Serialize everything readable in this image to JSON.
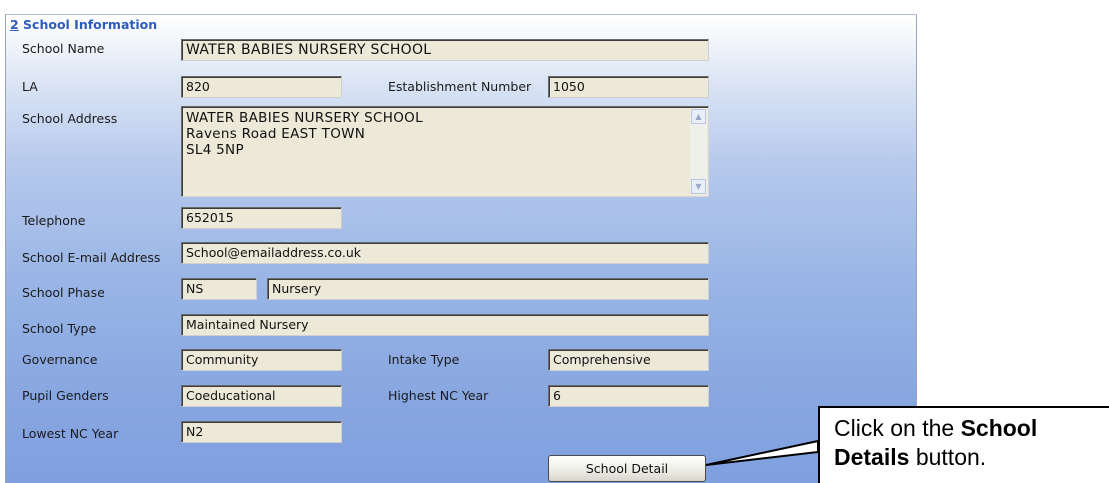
{
  "section": {
    "number": "2",
    "title": " School Information"
  },
  "labels": {
    "school_name": "School Name",
    "la": "LA",
    "establishment_number": "Establishment Number",
    "school_address": "School Address",
    "telephone": "Telephone",
    "email": "School E-mail Address",
    "phase": "School Phase",
    "type": "School Type",
    "governance": "Governance",
    "intake_type": "Intake Type",
    "pupil_genders": "Pupil Genders",
    "highest_nc_year": "Highest NC Year",
    "lowest_nc_year": "Lowest NC Year"
  },
  "values": {
    "school_name": "WATER BABIES NURSERY SCHOOL",
    "la": "820",
    "establishment_number": "1050",
    "address_lines": [
      "WATER BABIES NURSERY SCHOOL",
      "Ravens Road  EAST TOWN",
      "SL4 5NP"
    ],
    "telephone": "652015",
    "email": "School@emailaddress.co.uk",
    "phase_code": "NS",
    "phase_name": "Nursery",
    "type": "Maintained Nursery",
    "governance": "Community",
    "intake_type": "Comprehensive",
    "pupil_genders": "Coeducational",
    "highest_nc_year": "6",
    "lowest_nc_year": "N2"
  },
  "button": {
    "label": "School Detail"
  },
  "callout": {
    "pre": "Click on the ",
    "bold1": "School",
    "bold2": "Details",
    "post": " button."
  },
  "icons": {
    "scroll_up": "scroll-up-arrow",
    "scroll_down": "scroll-down-arrow"
  }
}
